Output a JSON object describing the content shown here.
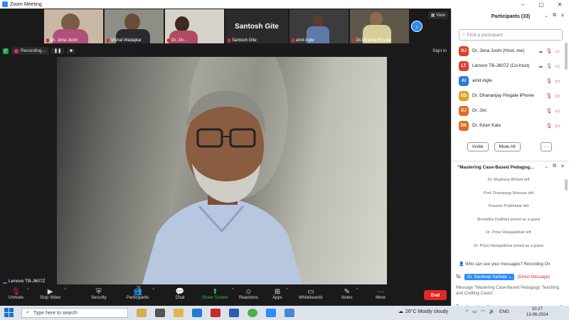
{
  "window": {
    "title": "Zoom Meeting",
    "controls": [
      "–",
      "▢",
      "✕"
    ]
  },
  "thumbnails": [
    {
      "name": "Dr. Jena Joshi",
      "type": "video",
      "bg": "#c9b8a6"
    },
    {
      "name": "Vishal Wadajkar",
      "type": "video",
      "bg": "#8e8e86"
    },
    {
      "name": "Dr. Jin...",
      "type": "video",
      "bg": "#d6d2cb"
    },
    {
      "name": "Santosh Gite",
      "type": "text",
      "big": "Santosh Gite"
    },
    {
      "name": "amit ingle",
      "type": "video",
      "bg": "#3c3c3c"
    },
    {
      "name": "Dr.Dhanraj Ruvate",
      "type": "video",
      "bg": "#5e574a"
    }
  ],
  "view_label": "View",
  "recording": {
    "label": "Recording...",
    "pause": "❚❚",
    "stop": "■"
  },
  "sign_in": "Sign in",
  "speaker_name": "Lenovo TB-J607Z",
  "toolbar": {
    "unmute": "Unmute",
    "stop_video": "Stop Video",
    "security": "Security",
    "participants": "Participants",
    "participants_count": "33",
    "chat": "Chat",
    "share_screen": "Share Screen",
    "reactions": "Reactions",
    "apps": "Apps",
    "whiteboards": "Whiteboards",
    "notes": "Notes",
    "more": "More",
    "end": "End"
  },
  "participants_panel": {
    "title": "Participants (33)",
    "search_placeholder": "Find a participant",
    "rows": [
      {
        "initials": "DJ",
        "name": "Dr. Jena Joshi (Host, me)",
        "color": "#d9432b"
      },
      {
        "initials": "LT",
        "name": "Lenovo TB-J607Z (Co-host)",
        "color": "#d9432b"
      },
      {
        "initials": "AI",
        "name": "amit ingle",
        "color": "#2b7cd3"
      },
      {
        "initials": "DD",
        "name": "Dr. Dhananjay Pingale iPhone",
        "color": "#e0a020"
      },
      {
        "initials": "DJ",
        "name": "Dr. Jini",
        "color": "#e26a1f"
      },
      {
        "initials": "DK",
        "name": "Dr. Kiran Kale",
        "color": "#e26a1f"
      }
    ],
    "invite": "Invite",
    "mute_all": "Mute All",
    "more": "···"
  },
  "chat_panel": {
    "title": "\"Mastering Case-Based Pedagog...",
    "messages": [
      "Dr. Meghana Bhilare left",
      "Prof. Dhananjay Bhavsar left",
      "Praveen Prabhakar left",
      "Shraddha Dudhani  joined as a guest",
      "Dr. Priya Vasagadekar left",
      "Dr. Priya Vasagadekar joined as a guest"
    ],
    "who_can_see": "Who can see your messages? Recording On",
    "to_label": "To:",
    "recipient": "Dr. Sandeep Sarkate ⌄",
    "direct": "(Direct Message)",
    "message_text": "Message \"Mastering Case-Based Pedagogy: Teaching and Crafting Cases\""
  },
  "taskbar": {
    "search_placeholder": "Type here to search",
    "weather": "26°C  Mostly cloudy",
    "lang": "ENG",
    "time": "10:27",
    "date": "13-06-2024"
  }
}
